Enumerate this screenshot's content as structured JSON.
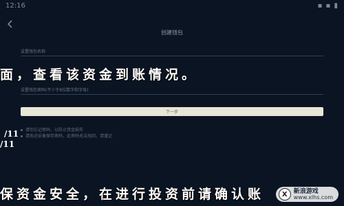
{
  "status_bar": {
    "time": "12:16",
    "right": "▪ ▪ ▮"
  },
  "page": {
    "title": "创建钱包"
  },
  "fields": [
    {
      "label": "设置钱包名称"
    },
    {
      "label": "设置钱包密码(不少于8位数字和字母)"
    }
  ],
  "overlay": {
    "line1": "面，查看该资金到账情况。",
    "line2": "保资金安全，在进行投资前请确认账"
  },
  "next_button": {
    "label": "下一步"
  },
  "hints": [
    "请勿忘记密码，以防止资金损失",
    "请务必妥善保存密码，此密码无法找回，请谨记"
  ],
  "markers": [
    "/11",
    "/11"
  ],
  "watermark": {
    "logo": "X",
    "name": "新浪游戏",
    "url": "www.xlhs.com"
  },
  "colors": {
    "background": "#0a1422",
    "button": "#e9e6d8",
    "overlay_text": "#ffffff"
  }
}
